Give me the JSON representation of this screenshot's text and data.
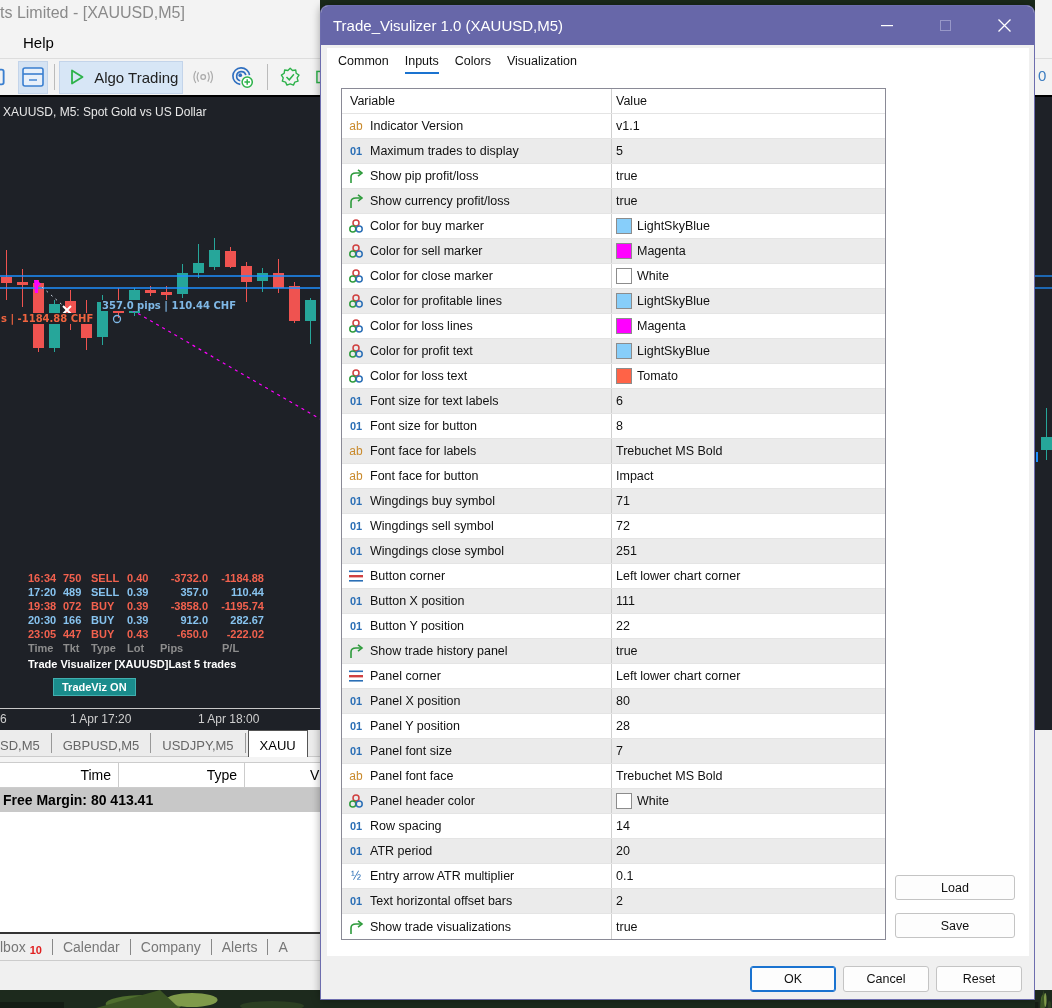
{
  "app": {
    "title": "ts Limited - [XAUUSD,M5]",
    "menu": [
      "Help"
    ],
    "toolbar": {
      "algo_trading": "Algo Trading",
      "right_text": "0"
    },
    "chart": {
      "header": "XAUUSD, M5:  Spot Gold vs US Dollar",
      "trade_labels": [
        {
          "text": "357.0 pips | 110.44 CHF",
          "color": "#7fb8e6"
        },
        {
          "text": "s | -1184.88 CHF",
          "color": "#f0643f"
        }
      ],
      "history": {
        "rows": [
          {
            "cells": [
              "16:34",
              "750",
              "SELL",
              "0.40",
              "-3732.0",
              "-1184.88"
            ],
            "color": "#f2614e"
          },
          {
            "cells": [
              "17:20",
              "489",
              "SELL",
              "0.39",
              "357.0",
              "110.44"
            ],
            "color": "#87c3ef"
          },
          {
            "cells": [
              "19:38",
              "072",
              "BUY",
              "0.39",
              "-3858.0",
              "-1195.74"
            ],
            "color": "#f2614e"
          },
          {
            "cells": [
              "20:30",
              "166",
              "BUY",
              "0.39",
              "912.0",
              "282.67"
            ],
            "color": "#87c3ef"
          },
          {
            "cells": [
              "23:05",
              "447",
              "BUY",
              "0.43",
              "-650.0",
              "-222.02"
            ],
            "color": "#f2614e"
          }
        ],
        "legend": [
          "Time",
          "Tkt",
          "Type",
          "Lot",
          "Pips",
          "P/L"
        ],
        "title": "Trade Visualizer [XAUUSD]Last 5 trades",
        "button": "TradeViz ON"
      },
      "time_axis": [
        "6",
        "1 Apr 17:20",
        "1 Apr 18:00"
      ]
    },
    "chart_tabs": [
      {
        "label": "SD,M5",
        "selected": false
      },
      {
        "label": "GBPUSD,M5",
        "selected": false
      },
      {
        "label": "USDJPY,M5",
        "selected": false
      },
      {
        "label": "XAUU",
        "selected": true
      }
    ],
    "table": {
      "columns": [
        "Time",
        "Type",
        "V"
      ],
      "summary": "Free Margin: 80 413.41"
    },
    "bottom_tabs": [
      {
        "label": "lbox",
        "badge": "10"
      },
      {
        "label": "Calendar"
      },
      {
        "label": "Company"
      },
      {
        "label": "Alerts"
      },
      {
        "label": "A"
      }
    ]
  },
  "dialog": {
    "title": "Trade_Visulizer 1.0 (XAUUSD,M5)",
    "tabs": [
      {
        "label": "Common",
        "selected": false
      },
      {
        "label": "Inputs",
        "selected": true
      },
      {
        "label": "Colors",
        "selected": false
      },
      {
        "label": "Visualization",
        "selected": false
      }
    ],
    "columns": [
      "Variable",
      "Value"
    ],
    "params": [
      {
        "kind": "string",
        "icon": "ab",
        "name": "Indicator Version",
        "value": "v1.1"
      },
      {
        "kind": "int",
        "icon": "01",
        "name": "Maximum trades to display",
        "value": "5"
      },
      {
        "kind": "bool",
        "name": "Show pip profit/loss",
        "value": "true"
      },
      {
        "kind": "bool",
        "name": "Show currency profit/loss",
        "value": "true"
      },
      {
        "kind": "color",
        "name": "Color for buy marker",
        "value": "LightSkyBlue",
        "color": "#87cefa"
      },
      {
        "kind": "color",
        "name": "Color for sell marker",
        "value": "Magenta",
        "color": "#ff00ff"
      },
      {
        "kind": "color",
        "name": "Color for close marker",
        "value": "White",
        "color": "#ffffff"
      },
      {
        "kind": "color",
        "name": "Color for profitable lines",
        "value": "LightSkyBlue",
        "color": "#87cefa"
      },
      {
        "kind": "color",
        "name": "Color for loss lines",
        "value": "Magenta",
        "color": "#ff00ff"
      },
      {
        "kind": "color",
        "name": "Color for profit text",
        "value": "LightSkyBlue",
        "color": "#87cefa"
      },
      {
        "kind": "color",
        "name": "Color for loss text",
        "value": "Tomato",
        "color": "#ff6347"
      },
      {
        "kind": "int",
        "icon": "01",
        "name": "Font size for text labels",
        "value": "6"
      },
      {
        "kind": "int",
        "icon": "01",
        "name": "Font size for button",
        "value": "8"
      },
      {
        "kind": "string",
        "icon": "ab",
        "name": "Font face for labels",
        "value": "Trebuchet MS Bold"
      },
      {
        "kind": "string",
        "icon": "ab",
        "name": "Font face for button",
        "value": "Impact"
      },
      {
        "kind": "int",
        "icon": "01",
        "name": "Wingdings buy symbol",
        "value": "71"
      },
      {
        "kind": "int",
        "icon": "01",
        "name": "Wingdings sell symbol",
        "value": "72"
      },
      {
        "kind": "int",
        "icon": "01",
        "name": "Wingdings close symbol",
        "value": "251"
      },
      {
        "kind": "enum",
        "name": "Button corner",
        "value": "Left lower chart corner"
      },
      {
        "kind": "int",
        "icon": "01",
        "name": "Button X position",
        "value": "111"
      },
      {
        "kind": "int",
        "icon": "01",
        "name": "Button Y position",
        "value": "22"
      },
      {
        "kind": "bool",
        "name": "Show trade history panel",
        "value": "true"
      },
      {
        "kind": "enum",
        "name": "Panel corner",
        "value": "Left lower chart corner"
      },
      {
        "kind": "int",
        "icon": "01",
        "name": "Panel X position",
        "value": "80"
      },
      {
        "kind": "int",
        "icon": "01",
        "name": "Panel Y position",
        "value": "28"
      },
      {
        "kind": "int",
        "icon": "01",
        "name": "Panel font size",
        "value": "7"
      },
      {
        "kind": "string",
        "icon": "ab",
        "name": "Panel font face",
        "value": "Trebuchet MS Bold"
      },
      {
        "kind": "color",
        "name": "Panel header color",
        "value": "White",
        "color": "#ffffff"
      },
      {
        "kind": "int",
        "icon": "01",
        "name": "Row spacing",
        "value": "14"
      },
      {
        "kind": "int",
        "icon": "01",
        "name": "ATR period",
        "value": "20"
      },
      {
        "kind": "double",
        "icon": "½",
        "name": "Entry arrow ATR multiplier",
        "value": "0.1"
      },
      {
        "kind": "int",
        "icon": "01",
        "name": "Text horizontal offset bars",
        "value": "2"
      },
      {
        "kind": "bool",
        "name": "Show trade visualizations",
        "value": "true"
      }
    ],
    "side_buttons": [
      "Load",
      "Save"
    ],
    "buttons": [
      {
        "label": "OK",
        "default": true
      },
      {
        "label": "Cancel",
        "default": false
      },
      {
        "label": "Reset",
        "default": false
      }
    ]
  }
}
